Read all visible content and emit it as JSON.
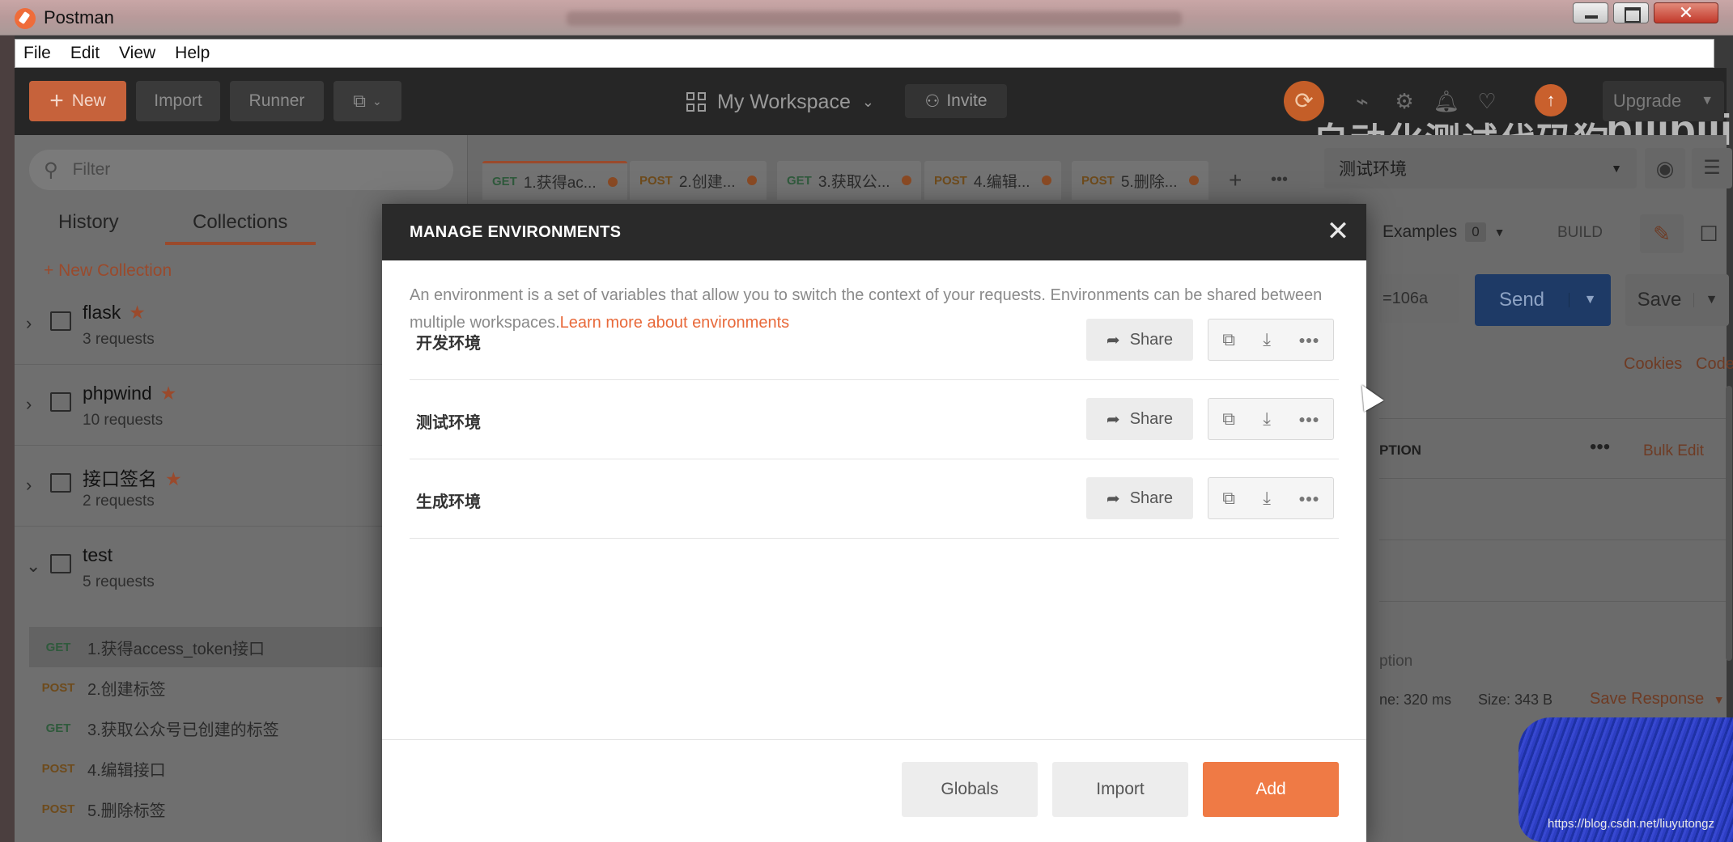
{
  "window": {
    "title": "Postman"
  },
  "menubar": {
    "items": [
      "File",
      "Edit",
      "View",
      "Help"
    ]
  },
  "header": {
    "new_label": "New",
    "import_label": "Import",
    "runner_label": "Runner",
    "workspace_label": "My Workspace",
    "invite_label": "Invite",
    "upgrade_label": "Upgrade",
    "watermark_text": "自动化测试代码狗",
    "watermark_logo": "bilibili",
    "accent_color": "#ef6c3a"
  },
  "sidebar": {
    "filter_placeholder": "Filter",
    "tabs": [
      "History",
      "Collections"
    ],
    "active_tab": "Collections",
    "new_collection_label": "+ New Collection",
    "collections": [
      {
        "name": "flask",
        "count": "3 requests",
        "starred": true
      },
      {
        "name": "phpwind",
        "count": "10 requests",
        "starred": true
      },
      {
        "name": "接口签名",
        "count": "2 requests",
        "starred": true
      },
      {
        "name": "test",
        "count": "5 requests",
        "starred": false
      }
    ],
    "requests": [
      {
        "method": "GET",
        "name": "1.获得access_token接口"
      },
      {
        "method": "POST",
        "name": "2.创建标签"
      },
      {
        "method": "GET",
        "name": "3.获取公众号已创建的标签"
      },
      {
        "method": "POST",
        "name": "4.编辑接口"
      },
      {
        "method": "POST",
        "name": "5.删除标签"
      }
    ]
  },
  "request_tabs": [
    {
      "method": "GET",
      "label": "1.获得ac..."
    },
    {
      "method": "POST",
      "label": "2.创建..."
    },
    {
      "method": "GET",
      "label": "3.获取公..."
    },
    {
      "method": "POST",
      "label": "4.编辑..."
    },
    {
      "method": "POST",
      "label": "5.删除..."
    }
  ],
  "right_panel": {
    "environment_selected": "测试环境",
    "examples_label": "Examples",
    "examples_count": "0",
    "build_label": "BUILD",
    "url_fragment": "=106a",
    "send_label": "Send",
    "save_label": "Save",
    "cookies_label": "Cookies",
    "code_label": "Code",
    "column_header_fragment": "PTION",
    "bulk_edit_label": "Bulk Edit",
    "description_placeholder_fragment": "ption",
    "response_time": "ne: 320 ms",
    "response_size": "Size:  343 B",
    "save_response_label": "Save Response"
  },
  "modal": {
    "title": "MANAGE ENVIRONMENTS",
    "description": "An environment is a set of variables that allow you to switch the context of your requests. Environments can be shared between multiple workspaces.",
    "learn_more": "Learn more about environments",
    "environments": [
      {
        "name": "开发环境",
        "share_label": "Share"
      },
      {
        "name": "测试环境",
        "share_label": "Share"
      },
      {
        "name": "生成环境",
        "share_label": "Share"
      }
    ],
    "globals_label": "Globals",
    "import_label": "Import",
    "add_label": "Add"
  },
  "footer_credit": "https://blog.csdn.net/liuyutongz"
}
